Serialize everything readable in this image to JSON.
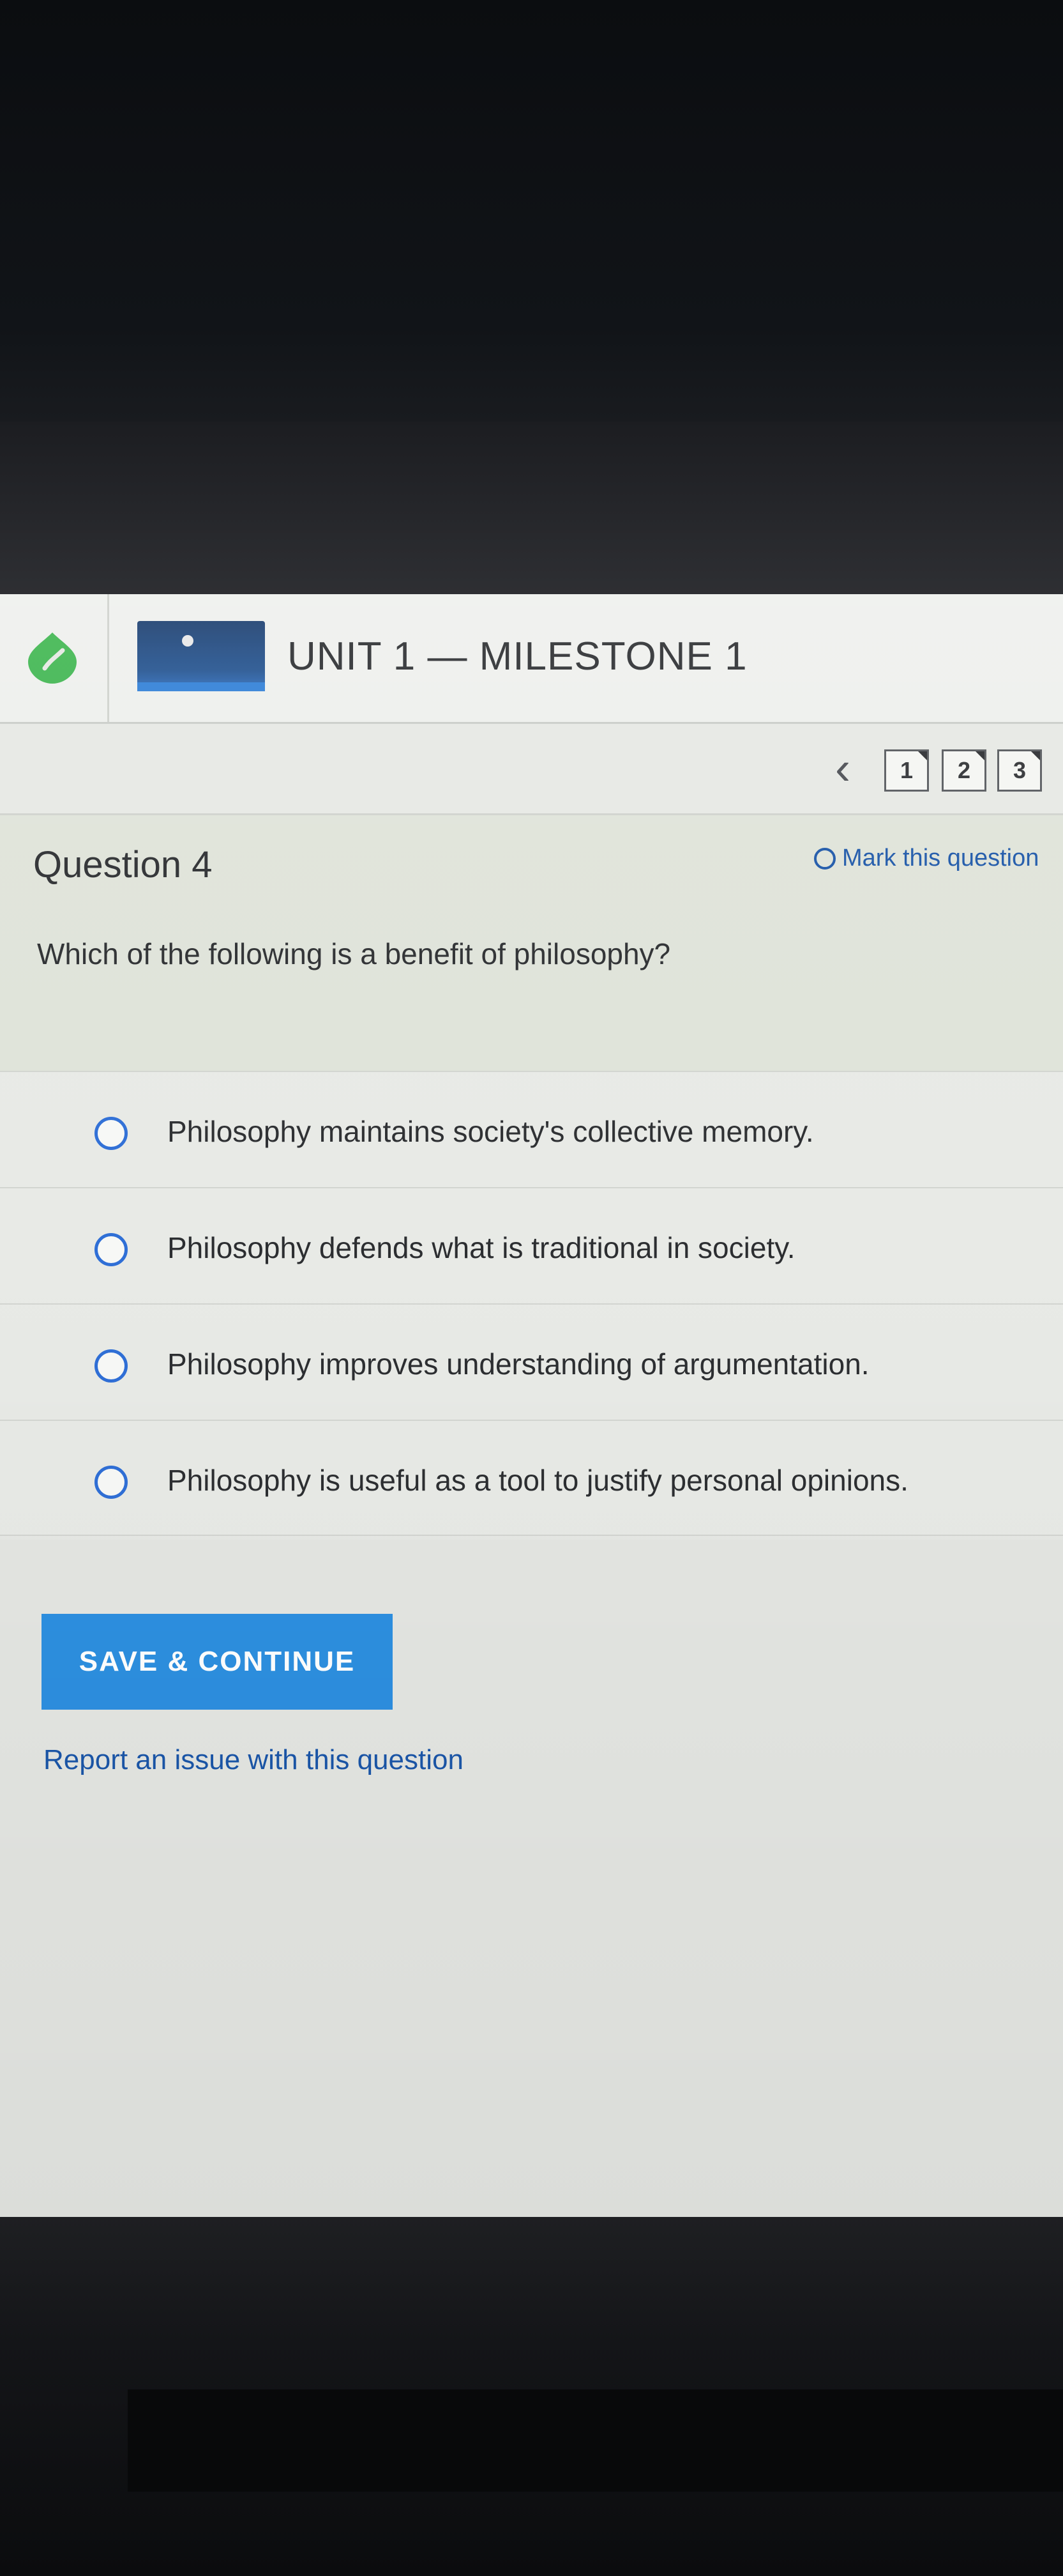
{
  "header": {
    "unit_title": "UNIT 1 — MILESTONE 1"
  },
  "navigation": {
    "prev_icon": "chevron-left",
    "question_tabs": [
      "1",
      "2",
      "3"
    ]
  },
  "question": {
    "label": "Question 4",
    "mark_label": "Mark this question",
    "text": "Which of the following is a benefit of philosophy?"
  },
  "answers": [
    "Philosophy maintains society's collective memory.",
    "Philosophy defends what is traditional in society.",
    "Philosophy improves understanding of argumentation.",
    "Philosophy is useful as a tool to justify personal opinions."
  ],
  "actions": {
    "save_label": "SAVE & CONTINUE",
    "report_label": "Report an issue with this question"
  },
  "colors": {
    "accent_blue": "#2d8fe0",
    "link_blue": "#1b56a8",
    "logo_green": "#3fb650"
  }
}
